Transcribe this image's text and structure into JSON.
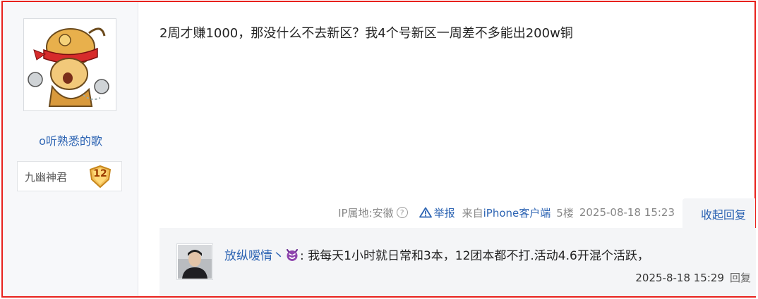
{
  "author": {
    "name": "o听熟悉的歌",
    "title": "九幽神君",
    "level": "12"
  },
  "post": {
    "content": "2周才赚1000，那没什么不去新区？我4个号新区一周差不多能出200w铜",
    "ip_location": "IP属地:安徽",
    "help_symbol": "?",
    "report_label": "举报",
    "from_prefix": "来自",
    "client": "iPhone客户端",
    "floor": "5楼",
    "timestamp": "2025-08-18 15:23",
    "collapse_label": "收起回复"
  },
  "reply": {
    "username": "放纵嗳情丶",
    "content": ": 我每天1小时就日常和3本，12团本都不打.活动4.6开混个活跃，",
    "timestamp": "2025-8-18 15:29",
    "reply_label": "回复"
  },
  "colors": {
    "link": "#2d64b3",
    "frame": "#e8221d",
    "panel": "#f4f5f7"
  }
}
